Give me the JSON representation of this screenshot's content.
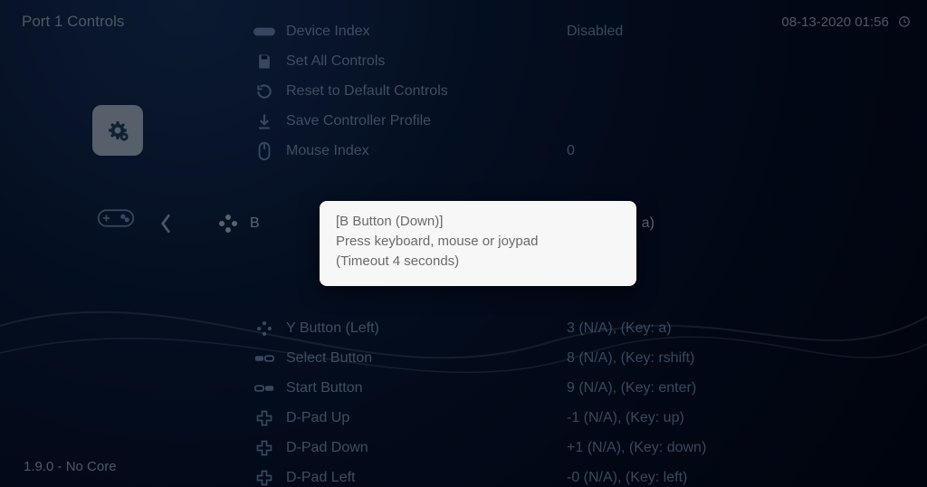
{
  "header": {
    "title": "Port 1 Controls",
    "datetime": "08-13-2020 01:56"
  },
  "side": {
    "settings_icon": "settings-icon",
    "controller_icon": "controller-icon",
    "back_icon": "chevron-left-icon"
  },
  "menu_top": [
    {
      "icon": "controller-icon",
      "label": "Device Index",
      "value": "Disabled"
    },
    {
      "icon": "save-icon",
      "label": "Set All Controls",
      "value": ""
    },
    {
      "icon": "reload-icon",
      "label": "Reset to Default Controls",
      "value": ""
    },
    {
      "icon": "download-icon",
      "label": "Save Controller Profile",
      "value": ""
    },
    {
      "icon": "mouse-icon",
      "label": "Mouse Index",
      "value": "0"
    }
  ],
  "menu_mid": [
    {
      "icon": "dpad-icon",
      "label": "B",
      "value": "N/A), (Key: a)"
    }
  ],
  "menu_bot": [
    {
      "icon": "dpad-icon",
      "label": "Y Button (Left)",
      "value": "3 (N/A), (Key: a)"
    },
    {
      "icon": "select-icon",
      "label": "Select Button",
      "value": "8 (N/A), (Key: rshift)"
    },
    {
      "icon": "start-icon",
      "label": "Start Button",
      "value": "9 (N/A), (Key: enter)"
    },
    {
      "icon": "plus-icon",
      "label": "D-Pad Up",
      "value": "-1 (N/A), (Key: up)"
    },
    {
      "icon": "plus-icon",
      "label": "D-Pad Down",
      "value": "+1 (N/A), (Key: down)"
    },
    {
      "icon": "plus-icon",
      "label": "D-Pad Left",
      "value": "-0 (N/A), (Key: left)"
    }
  ],
  "dialog": {
    "line1": "[B Button (Down)]",
    "line2": "Press keyboard, mouse or joypad",
    "line3": "(Timeout 4 seconds)"
  },
  "footer": {
    "version": "1.9.0 - No Core"
  }
}
